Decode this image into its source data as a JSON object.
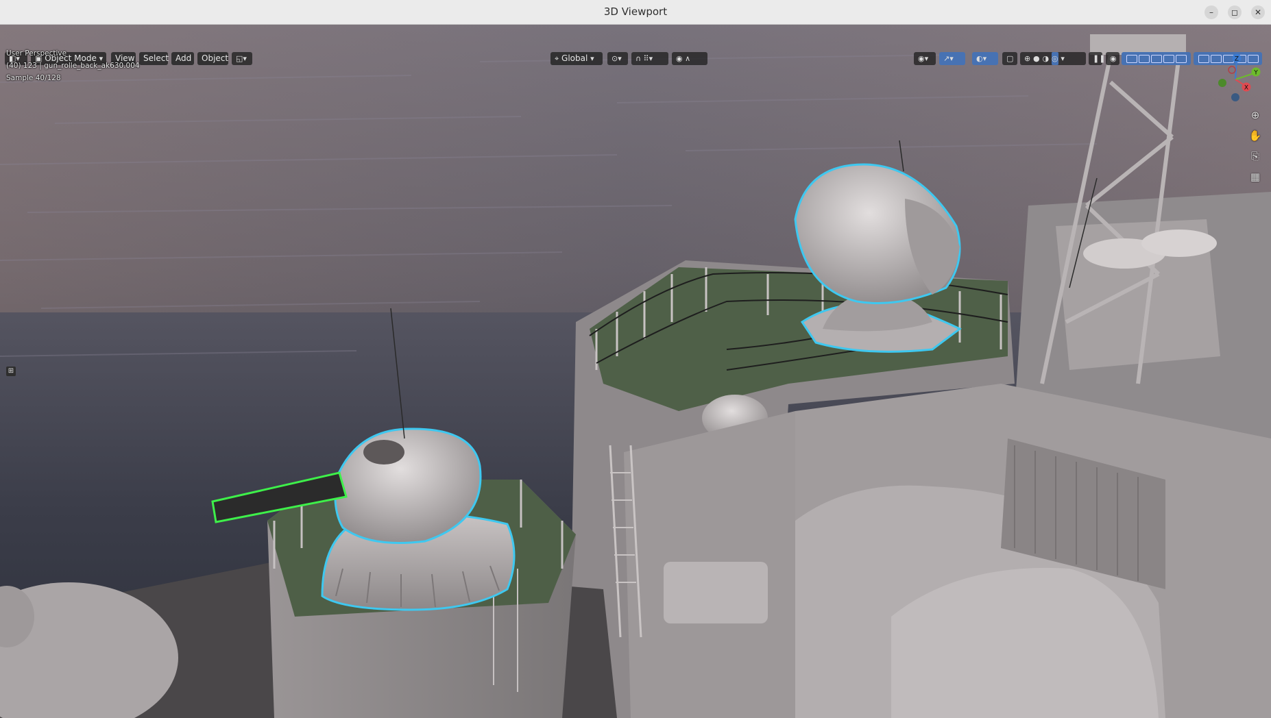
{
  "window": {
    "title": "3D Viewport"
  },
  "window_controls": {
    "minimize": "–",
    "maximize": "◻",
    "close": "✕"
  },
  "header": {
    "mode_label": "Object Mode",
    "menus": [
      "View",
      "Select",
      "Add",
      "Object"
    ],
    "transform_orientation": "Global"
  },
  "overlay": {
    "view_name": "User Perspective",
    "object_info": "(40) 123 | gun_rolle_back_ak630.004",
    "sample": "Sample 40/128"
  },
  "gizmo": {
    "x": "X",
    "y": "Y",
    "z": "Z"
  },
  "colors": {
    "selection_outline": "#3ec8f0",
    "active_outline": "#3ef04a",
    "header_button_active": "#4772b3"
  }
}
